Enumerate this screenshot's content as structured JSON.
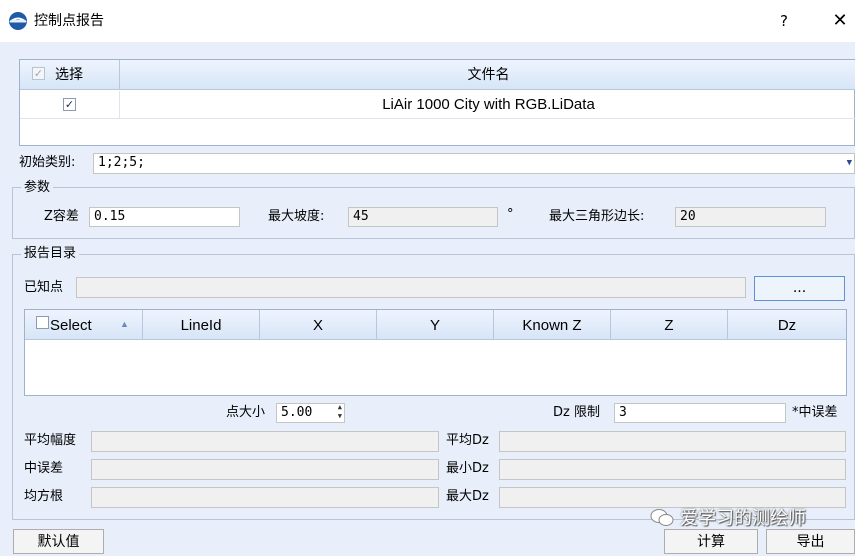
{
  "window": {
    "title": "控制点报告",
    "help": "?",
    "close": "✕"
  },
  "file_table": {
    "headers": {
      "select": "选择",
      "filename": "文件名"
    },
    "rows": [
      {
        "checked": "✓",
        "filename": "LiAir 1000 City with RGB.LiData"
      }
    ]
  },
  "initial_class": {
    "label": "初始类别:",
    "value": "1;2;5;"
  },
  "params": {
    "title": "参数",
    "z_tolerance_label": "Z容差",
    "z_tolerance_value": "0.15",
    "max_slope_label": "最大坡度:",
    "max_slope_value": "45",
    "degree_symbol": "°",
    "max_edge_label": "最大三角形边长:",
    "max_edge_value": "20"
  },
  "report": {
    "title": "报告目录",
    "known_points_label": "已知点",
    "browse_label": "...",
    "columns": [
      "Select",
      "LineId",
      "X",
      "Y",
      "Known Z",
      "Z",
      "Dz"
    ],
    "point_size_label": "点大小",
    "point_size_value": "5.00",
    "dz_limit_label": "Dz 限制",
    "dz_limit_value": "3",
    "dz_limit_suffix": "*中误差",
    "stats": {
      "avg_range": "平均幅度",
      "rmse": "中误差",
      "rms": "均方根",
      "avg_dz": "平均Dz",
      "min_dz": "最小Dz",
      "max_dz": "最大Dz"
    }
  },
  "buttons": {
    "default": "默认值",
    "calculate": "计算",
    "export": "导出"
  },
  "watermark": "爱学习的测绘师"
}
